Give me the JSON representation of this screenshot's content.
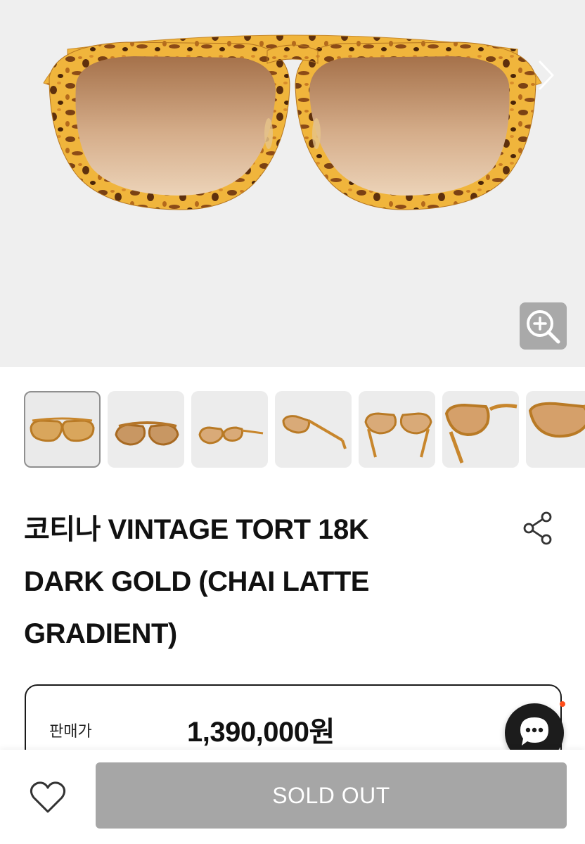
{
  "product": {
    "title_lines": [
      "코티나 VINTAGE TORT 18K",
      "DARK GOLD (CHAI LATTE",
      "GRADIENT)"
    ]
  },
  "gallery": {
    "thumbnail_count": 7,
    "active_index": 0,
    "icons": {
      "next": "chevron-right-icon",
      "zoom": "zoom-in-icon"
    }
  },
  "price": {
    "label": "판매가",
    "value": "1,390,000원"
  },
  "actions": {
    "sold_out_label": "SOLD OUT",
    "icons": {
      "wishlist": "heart-icon",
      "share": "share-icon",
      "chat": "chat-icon"
    }
  },
  "colors": {
    "hero_bg": "#efefef",
    "sold_out_bg": "#a6a6a6",
    "chat_bg": "#1c1c1c",
    "chat_badge": "#ff4d1a",
    "tortoise_light": "#f0b53c",
    "tortoise_dark": "#6e3a12",
    "lens_top": "#a5714a",
    "lens_bottom": "#ecd3b8"
  }
}
